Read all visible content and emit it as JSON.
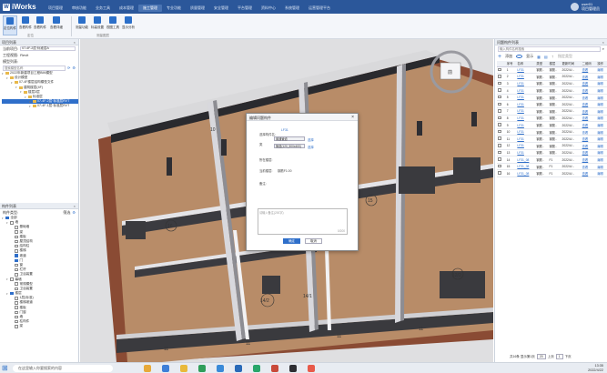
{
  "app": {
    "title": "iWorks",
    "logo_glyph": "W"
  },
  "menu": [
    "项目管理",
    "审核功能",
    "业务工具",
    "成本管理",
    "施工管理",
    "专业功能",
    "质量管理",
    "安全管理",
    "平台管理",
    "资料中心",
    "系统管理",
    "运营管理平台"
  ],
  "active_menu_index": 4,
  "user": {
    "name": "user01",
    "role": "项目管理员"
  },
  "ribbon": {
    "buttons": [
      {
        "label": "定位构件",
        "icon": "locate-icon"
      },
      {
        "label": "查看构件",
        "icon": "view-icon"
      },
      {
        "label": "查看构件",
        "icon": "view-icon"
      },
      {
        "label": "查看详细",
        "icon": "detail-icon"
      },
      {
        "label": "测量功能",
        "icon": "measure-icon"
      },
      {
        "label": "标高设置",
        "icon": "elevation-icon"
      },
      {
        "label": "视图工具",
        "icon": "view-tool-icon"
      },
      {
        "label": "显示分析",
        "icon": "analysis-icon"
      }
    ],
    "groups": [
      "定位",
      "测量图层"
    ]
  },
  "left_top": {
    "title": "项目列表",
    "project_label": "当前项目:",
    "project_value": "07-4F-2层·标准层A",
    "view_label": "工程视图:",
    "view_value": "Revit",
    "model_label": "模型列表:",
    "search_placeholder": "搜索模型名称",
    "tree": [
      {
        "label": "2022年新建项目工程BIM模型",
        "level": 0
      },
      {
        "label": "设计模型",
        "level": 1
      },
      {
        "label": "07-4F楼层结构模型文件",
        "level": 2
      },
      {
        "label": "建筑楼层(4F)",
        "level": 3
      },
      {
        "label": "楼层3层",
        "level": 4
      },
      {
        "label": "标准层",
        "level": 5
      },
      {
        "label": "07-4F-2层·标准层RVT",
        "level": 6,
        "selected": true
      },
      {
        "label": "07-4F-1层·标准层RVT",
        "level": 6
      }
    ]
  },
  "left_bottom": {
    "title": "构件列表",
    "filter_label": "构件类型:",
    "filter_btn": "筛选",
    "items": [
      {
        "label": "全部",
        "level": 0,
        "checked": true
      },
      {
        "label": "墙",
        "level": 1,
        "checked": false
      },
      {
        "label": "基础墙",
        "level": 2,
        "checked": false
      },
      {
        "label": "梁",
        "level": 2,
        "checked": false
      },
      {
        "label": "楼板",
        "level": 2,
        "checked": false
      },
      {
        "label": "屋顶结构",
        "level": 2,
        "checked": false
      },
      {
        "label": "结构柱",
        "level": 2,
        "checked": false
      },
      {
        "label": "楼梯",
        "level": 2,
        "checked": false
      },
      {
        "label": "坡道",
        "level": 2,
        "checked": true
      },
      {
        "label": "门",
        "level": 2,
        "checked": true
      },
      {
        "label": "窗",
        "level": 2,
        "checked": false
      },
      {
        "label": "栏杆",
        "level": 2,
        "checked": false
      },
      {
        "label": "卫浴装置",
        "level": 2,
        "checked": false
      },
      {
        "label": "幕墙",
        "level": 1,
        "checked": false
      },
      {
        "label": "常规模型",
        "level": 2,
        "checked": false
      },
      {
        "label": "卫浴装置",
        "level": 2,
        "checked": false
      },
      {
        "label": "楼层",
        "level": 1,
        "checked": true
      },
      {
        "label": "1层(标准)",
        "level": 2,
        "checked": false
      },
      {
        "label": "楼梯坡道",
        "level": 2,
        "checked": false
      },
      {
        "label": "楼板",
        "level": 2,
        "checked": false
      },
      {
        "label": "门窗",
        "level": 2,
        "checked": false
      },
      {
        "label": "墙",
        "level": 2,
        "checked": false
      },
      {
        "label": "柱构件",
        "level": 2,
        "checked": false
      },
      {
        "label": "梁",
        "level": 2,
        "checked": false
      }
    ]
  },
  "viewport": {
    "labels": [
      "16",
      "15",
      "14/2",
      "14/1",
      "12/2",
      "11",
      "11",
      "11",
      "11",
      "10"
    ],
    "navcube_label": "前"
  },
  "right": {
    "title": "问题构件列表",
    "search_placeholder": "输入构件名称搜索",
    "toolbar": [
      "添加",
      "显示",
      "日程",
      "",
      "指定类型"
    ],
    "columns": [
      "",
      "序号",
      "名称",
      "类型",
      "楼层",
      "更新时间",
      "二维码",
      "操作"
    ],
    "rows": [
      {
        "no": "1",
        "name": "LF31",
        "type": "钢筋..",
        "floor": "钢筋..",
        "time": "2022/4/...",
        "qr": "查看",
        "op": "编辑"
      },
      {
        "no": "2",
        "name": "LF31",
        "type": "钢筋..",
        "floor": "钢筋..",
        "time": "2022/4/...",
        "qr": "查看",
        "op": "编辑"
      },
      {
        "no": "3",
        "name": "LF31",
        "type": "钢筋..",
        "floor": "钢筋..",
        "time": "2022/4/...",
        "qr": "查看",
        "op": "编辑"
      },
      {
        "no": "4",
        "name": "LF31",
        "type": "钢筋..",
        "floor": "钢筋..",
        "time": "2022/4/...",
        "qr": "查看",
        "op": "编辑"
      },
      {
        "no": "5",
        "name": "LF31",
        "type": "钢筋..",
        "floor": "钢筋..",
        "time": "2022/4/...",
        "qr": "查看",
        "op": "编辑"
      },
      {
        "no": "6",
        "name": "LF31",
        "type": "钢筋..",
        "floor": "钢筋..",
        "time": "2022/4/...",
        "qr": "查看",
        "op": "编辑"
      },
      {
        "no": "7",
        "name": "LF31",
        "type": "钢筋..",
        "floor": "钢筋..",
        "time": "2022/4/...",
        "qr": "查看",
        "op": "编辑"
      },
      {
        "no": "8",
        "name": "LF31",
        "type": "钢筋..",
        "floor": "钢筋..",
        "time": "2022/4/...",
        "qr": "查看",
        "op": "编辑"
      },
      {
        "no": "9",
        "name": "LF31",
        "type": "钢筋..",
        "floor": "钢筋..",
        "time": "2022/4/...",
        "qr": "查看",
        "op": "编辑"
      },
      {
        "no": "10",
        "name": "LF31",
        "type": "钢筋..",
        "floor": "钢筋..",
        "time": "2022/4/...",
        "qr": "查看",
        "op": "编辑"
      },
      {
        "no": "11",
        "name": "LF31",
        "type": "钢筋..",
        "floor": "钢筋..",
        "time": "2022/4/...",
        "qr": "查看",
        "op": "编辑"
      },
      {
        "no": "12",
        "name": "LF31",
        "type": "钢筋..",
        "floor": "钢筋..",
        "time": "2022/4/...",
        "qr": "查看",
        "op": "编辑"
      },
      {
        "no": "13",
        "name": "LF31",
        "type": "钢筋..",
        "floor": "钢筋..",
        "time": "2022/4/...",
        "qr": "查看",
        "op": "编辑"
      },
      {
        "no": "14",
        "name": "LF31_08",
        "type": "钢筋..",
        "floor": "F1",
        "time": "2022/4/...",
        "qr": "查看",
        "op": "编辑"
      },
      {
        "no": "15",
        "name": "LF31_08",
        "type": "钢筋..",
        "floor": "F1",
        "time": "2022/4/...",
        "qr": "查看",
        "op": "编辑"
      },
      {
        "no": "16",
        "name": "LF31_08",
        "type": "钢筋..",
        "floor": "F1",
        "time": "2022/4/...",
        "qr": "查看",
        "op": "编辑"
      }
    ],
    "pager": {
      "total": "共16条 显示第1页",
      "per_page": "20",
      "prev": "上页",
      "page": "1",
      "next": "下页"
    }
  },
  "dialog": {
    "title": "编辑问题构件",
    "close": "×",
    "f1_label": "选择构件名:",
    "f1_value": "LF31",
    "f2_label": "类",
    "f2_value": "普通管道",
    "f2_btn": "选择",
    "f3_value": "管道(120_500x400)",
    "f3_btn": "选择",
    "f4_label": "所在楼层:",
    "f5_label": "当前楼层:",
    "f5_value": "钢筋F1.00",
    "f6_label": "备注:",
    "textarea_placeholder": "请输入备注(200字)",
    "counter": "0/200",
    "ok": "确定",
    "cancel": "取消"
  },
  "taskbar": {
    "search_placeholder": "在这里输入你要搜索的内容",
    "time": "13:35",
    "date": "2022/4/22"
  }
}
